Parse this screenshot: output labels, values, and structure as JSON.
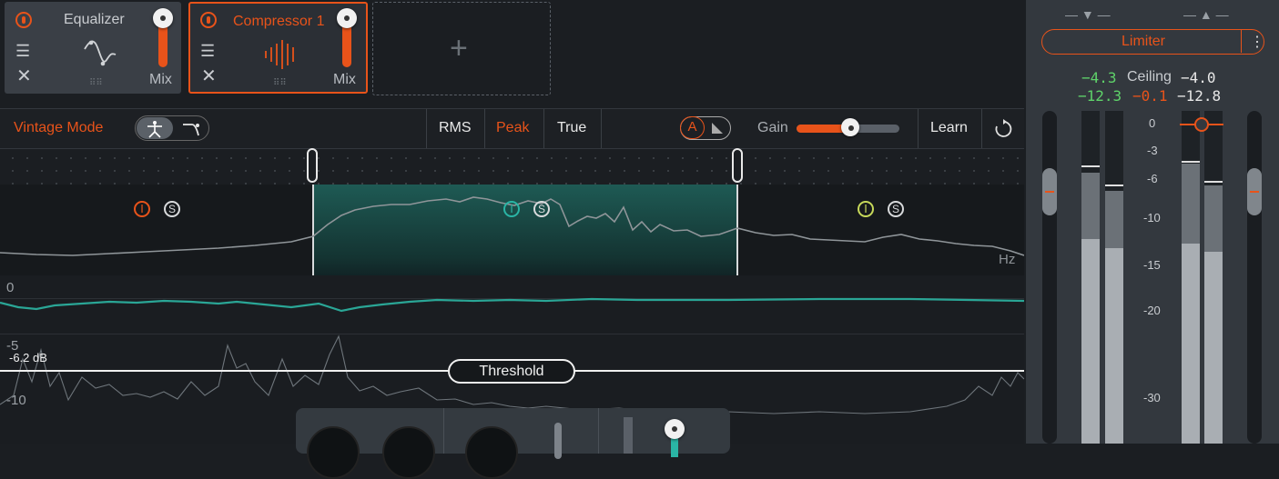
{
  "modules": [
    {
      "title": "Equalizer",
      "mix_label": "Mix",
      "mix_value": 0.85
    },
    {
      "title": "Compressor 1",
      "mix_label": "Mix",
      "mix_value": 0.85
    },
    {
      "add_icon": "plus-icon"
    }
  ],
  "toolbar": {
    "vintage_mode": "Vintage Mode",
    "rms": "RMS",
    "peak": "Peak",
    "true": "True",
    "a_label": "A",
    "gain_label": "Gain",
    "gain_value": 0.52,
    "learn": "Learn"
  },
  "bands": [
    {
      "solo": "S",
      "color": "#e8531a"
    },
    {
      "solo": "S",
      "color": "#2ab5a5"
    },
    {
      "solo": "S",
      "color": "#c7d95a"
    }
  ],
  "spectrum_unit": "Hz",
  "waveform": {
    "zero_label": "0",
    "minus5_label": "-5",
    "minus10_label": "-10",
    "threshold_value": "-6.2 dB",
    "threshold_label": "Threshold"
  },
  "limiter": {
    "title": "Limiter",
    "in_peak": "−4.3",
    "in_rms": "−12.3",
    "ceiling_label": "Ceiling",
    "ceiling_value": "−4.0",
    "gr": "−0.1",
    "out_rms": "−12.8",
    "scale": [
      "0",
      "-3",
      "-6",
      "-10",
      "-15",
      "-20",
      "-30"
    ]
  },
  "colors": {
    "accent": "#e8531a",
    "teal": "#2ab5a5",
    "green": "#5fd36a"
  }
}
